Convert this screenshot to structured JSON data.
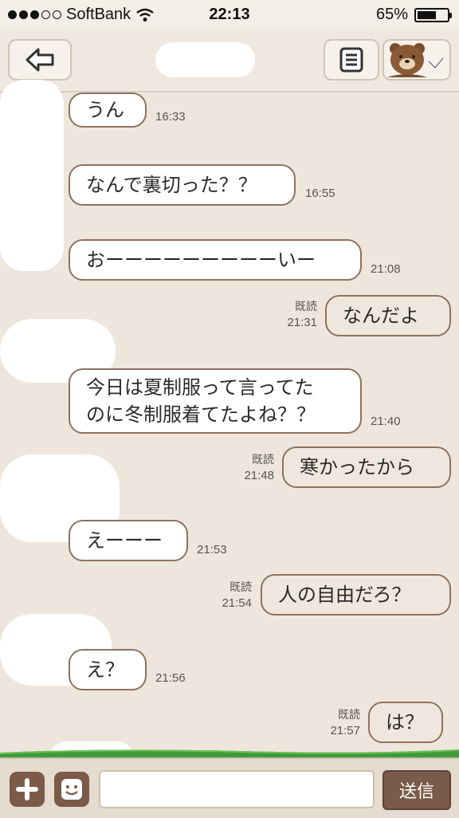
{
  "status_bar": {
    "carrier": "SoftBank",
    "time": "22:13",
    "battery": "65%",
    "battery_level": 0.65
  },
  "chat": {
    "messages": [
      {
        "side": "received",
        "text": "うん",
        "time": "16:33"
      },
      {
        "side": "received",
        "text": "なんで裏切った？？",
        "time": "16:55"
      },
      {
        "side": "received",
        "text": "おーーーーーーーーーいー",
        "time": "21:08"
      },
      {
        "side": "sent",
        "text": "なんだよ",
        "read": "既読",
        "time": "21:31"
      },
      {
        "side": "received",
        "text_line1": "今日は夏制服って言ってた",
        "text_line2": "のに冬制服着てたよね？？",
        "time": "21:40"
      },
      {
        "side": "sent",
        "text": "寒かったから",
        "read": "既読",
        "time": "21:48"
      },
      {
        "side": "received",
        "text": "えーーー",
        "time": "21:53"
      },
      {
        "side": "sent",
        "text": "人の自由だろ？",
        "read": "既読",
        "time": "21:54"
      },
      {
        "side": "received",
        "text": "え？",
        "time": "21:56"
      },
      {
        "side": "sent",
        "text": "は？",
        "read": "既読",
        "time": "21:57"
      }
    ]
  },
  "input_bar": {
    "send_label": "送信",
    "placeholder": ""
  },
  "icons": {
    "back": "back-arrow-icon",
    "menu": "menu-list-icon",
    "friend": "bear-sticker-icon",
    "plus": "plus-icon",
    "sticker": "smiley-icon",
    "wifi": "wifi-icon"
  },
  "colors": {
    "bubble_border": "#8d7260",
    "send_button": "#7a5a4a",
    "background": "#eee6dc"
  }
}
